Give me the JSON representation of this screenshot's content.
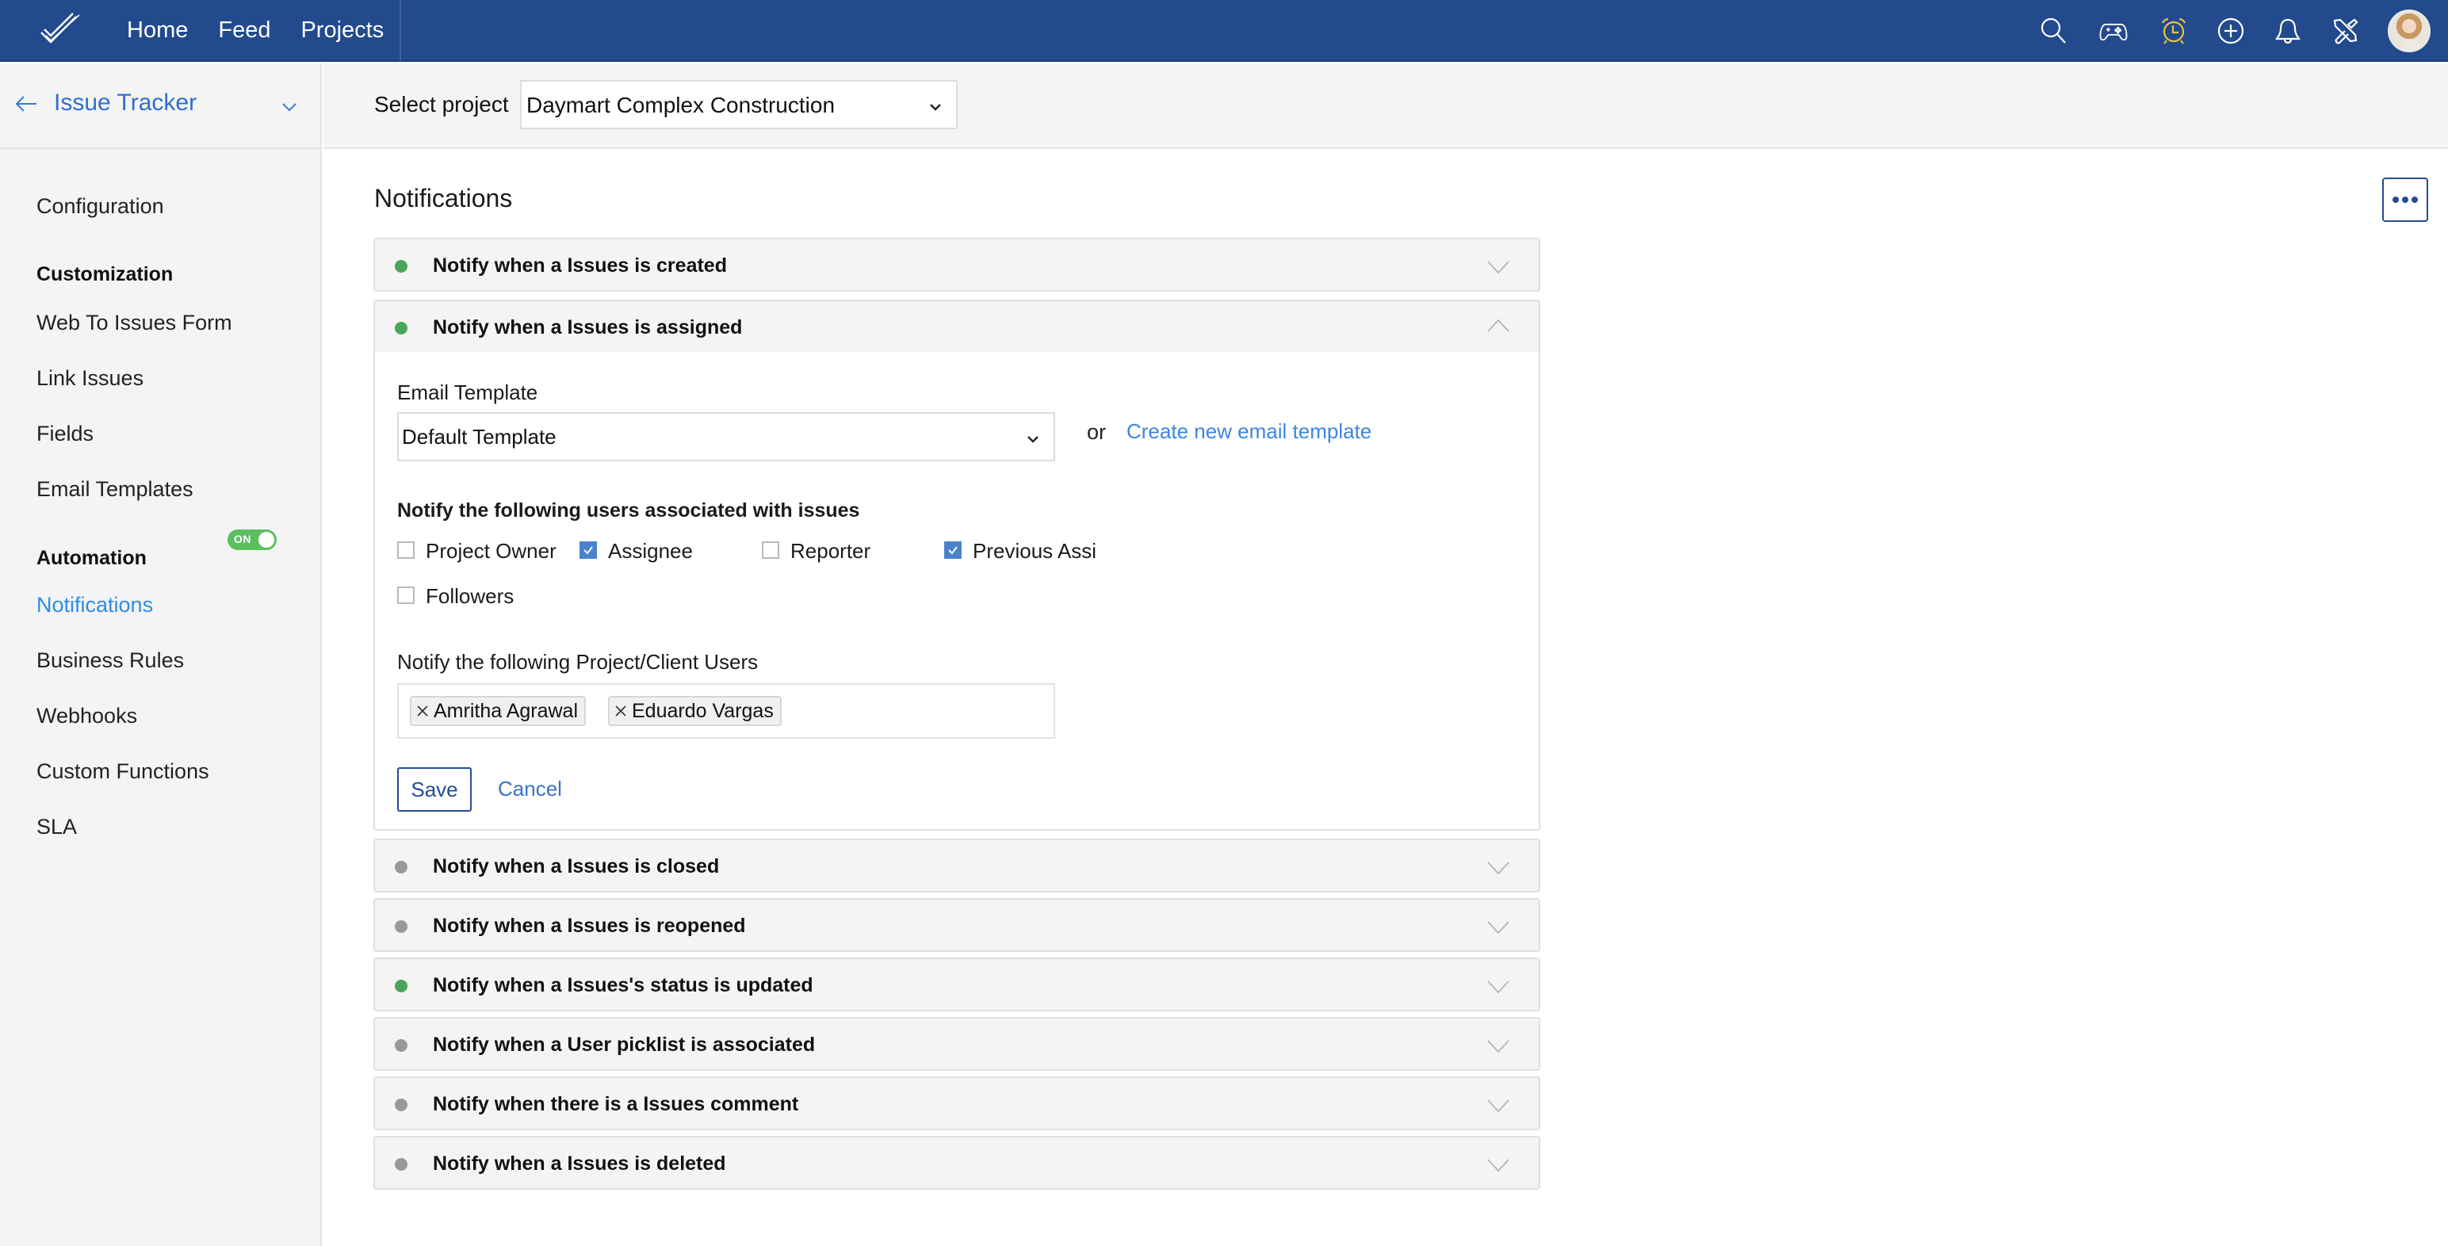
{
  "topbar": {
    "nav": [
      "Home",
      "Feed",
      "Projects"
    ],
    "icons": [
      "search-icon",
      "game-controller-icon",
      "alarm-clock-icon",
      "add-circle-icon",
      "bell-icon",
      "tools-icon"
    ],
    "accent_alarm": "#f0c23b",
    "brand_color": "#224a8d"
  },
  "sidebar": {
    "module_title": "Issue Tracker",
    "items": [
      {
        "label": "Configuration",
        "type": "item"
      },
      {
        "label": "Customization",
        "type": "group"
      },
      {
        "label": "Web To Issues Form",
        "type": "item"
      },
      {
        "label": "Link Issues",
        "type": "item"
      },
      {
        "label": "Fields",
        "type": "item"
      },
      {
        "label": "Email Templates",
        "type": "item"
      },
      {
        "label": "Automation",
        "type": "group"
      },
      {
        "label": "Notifications",
        "type": "item",
        "active": true
      },
      {
        "label": "Business Rules",
        "type": "item"
      },
      {
        "label": "Webhooks",
        "type": "item"
      },
      {
        "label": "Custom Functions",
        "type": "item"
      },
      {
        "label": "SLA",
        "type": "item"
      }
    ],
    "notifications_toggle": {
      "label": "ON",
      "state": true
    }
  },
  "project_bar": {
    "label": "Select project",
    "selected": "Daymart Complex Construction"
  },
  "main": {
    "title": "Notifications",
    "notifications": [
      {
        "title": "Notify when a Issues is created",
        "enabled": true,
        "expanded": false
      },
      {
        "title": "Notify when a Issues is assigned",
        "enabled": true,
        "expanded": true
      },
      {
        "title": "Notify when a Issues is closed",
        "enabled": false,
        "expanded": false
      },
      {
        "title": "Notify when a Issues is reopened",
        "enabled": false,
        "expanded": false
      },
      {
        "title": "Notify when a Issues's status is updated",
        "enabled": true,
        "expanded": false
      },
      {
        "title": "Notify when a User picklist is associated",
        "enabled": false,
        "expanded": false
      },
      {
        "title": "Notify when there is a Issues comment",
        "enabled": false,
        "expanded": false
      },
      {
        "title": "Notify when a Issues is deleted",
        "enabled": false,
        "expanded": false
      }
    ],
    "status_colors": {
      "enabled": "#4aa55a",
      "disabled": "#999999"
    },
    "expanded_panel": {
      "email_template_label": "Email Template",
      "email_template_value": "Default Template",
      "or_text": "or",
      "create_template_link": "Create new email template",
      "users_heading": "Notify the following users associated with issues",
      "user_roles": [
        {
          "label": "Project Owner",
          "checked": false
        },
        {
          "label": "Assignee",
          "checked": true
        },
        {
          "label": "Reporter",
          "checked": false
        },
        {
          "label": "Previous Assignee",
          "checked": true
        },
        {
          "label": "Followers",
          "checked": false
        }
      ],
      "client_users_label": "Notify the following Project/Client Users",
      "client_users": [
        "Amritha Agrawal",
        "Eduardo Vargas"
      ],
      "save_label": "Save",
      "cancel_label": "Cancel"
    }
  }
}
